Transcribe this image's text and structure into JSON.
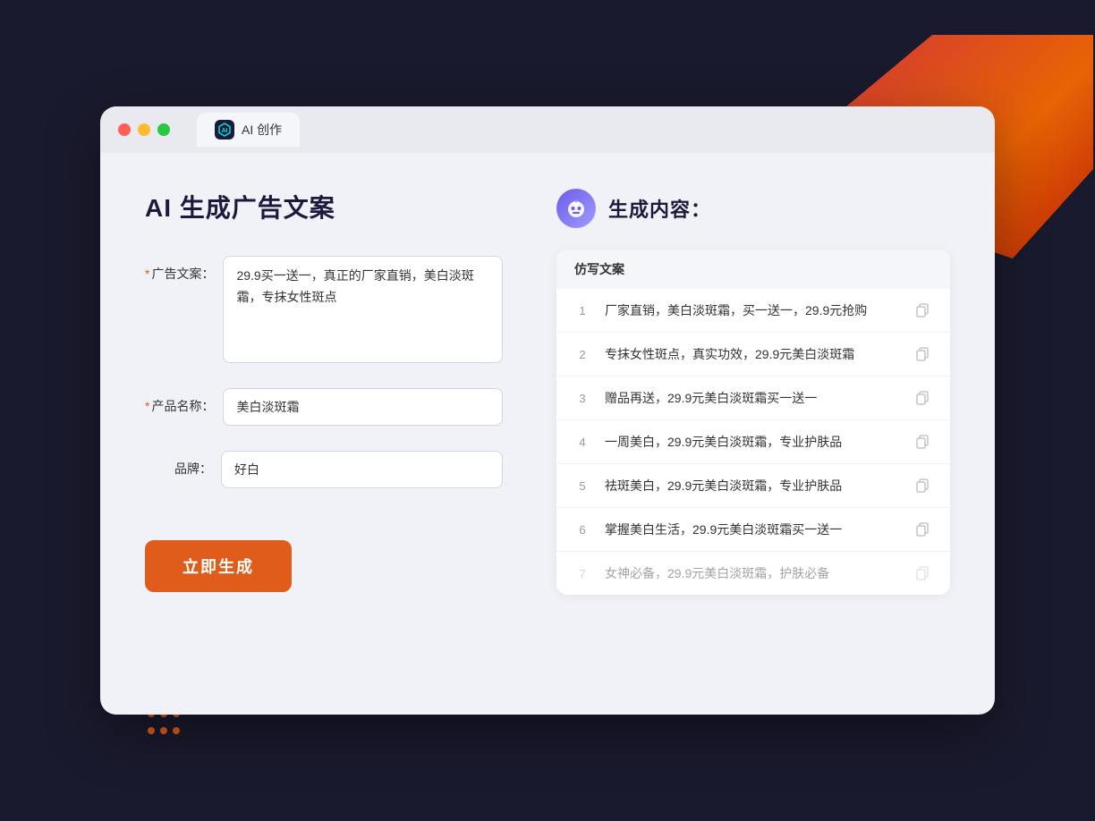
{
  "browser": {
    "tab_icon_label": "AI",
    "tab_title": "AI 创作"
  },
  "left_panel": {
    "page_title": "AI 生成广告文案",
    "form": {
      "ad_copy_label": "广告文案：",
      "ad_copy_required": "*",
      "ad_copy_value": "29.9买一送一，真正的厂家直销，美白淡斑霜，专抹女性斑点",
      "product_name_label": "产品名称：",
      "product_name_required": "*",
      "product_name_value": "美白淡斑霜",
      "brand_label": "品牌：",
      "brand_value": "好白",
      "generate_btn": "立即生成"
    }
  },
  "right_panel": {
    "title": "生成内容：",
    "column_header": "仿写文案",
    "results": [
      {
        "num": "1",
        "text": "厂家直销，美白淡斑霜，买一送一，29.9元抢购",
        "faded": false
      },
      {
        "num": "2",
        "text": "专抹女性斑点，真实功效，29.9元美白淡斑霜",
        "faded": false
      },
      {
        "num": "3",
        "text": "赠品再送，29.9元美白淡斑霜买一送一",
        "faded": false
      },
      {
        "num": "4",
        "text": "一周美白，29.9元美白淡斑霜，专业护肤品",
        "faded": false
      },
      {
        "num": "5",
        "text": "祛斑美白，29.9元美白淡斑霜，专业护肤品",
        "faded": false
      },
      {
        "num": "6",
        "text": "掌握美白生活，29.9元美白淡斑霜买一送一",
        "faded": false
      },
      {
        "num": "7",
        "text": "女神必备，29.9元美白淡斑霜，护肤必备",
        "faded": true
      }
    ]
  }
}
